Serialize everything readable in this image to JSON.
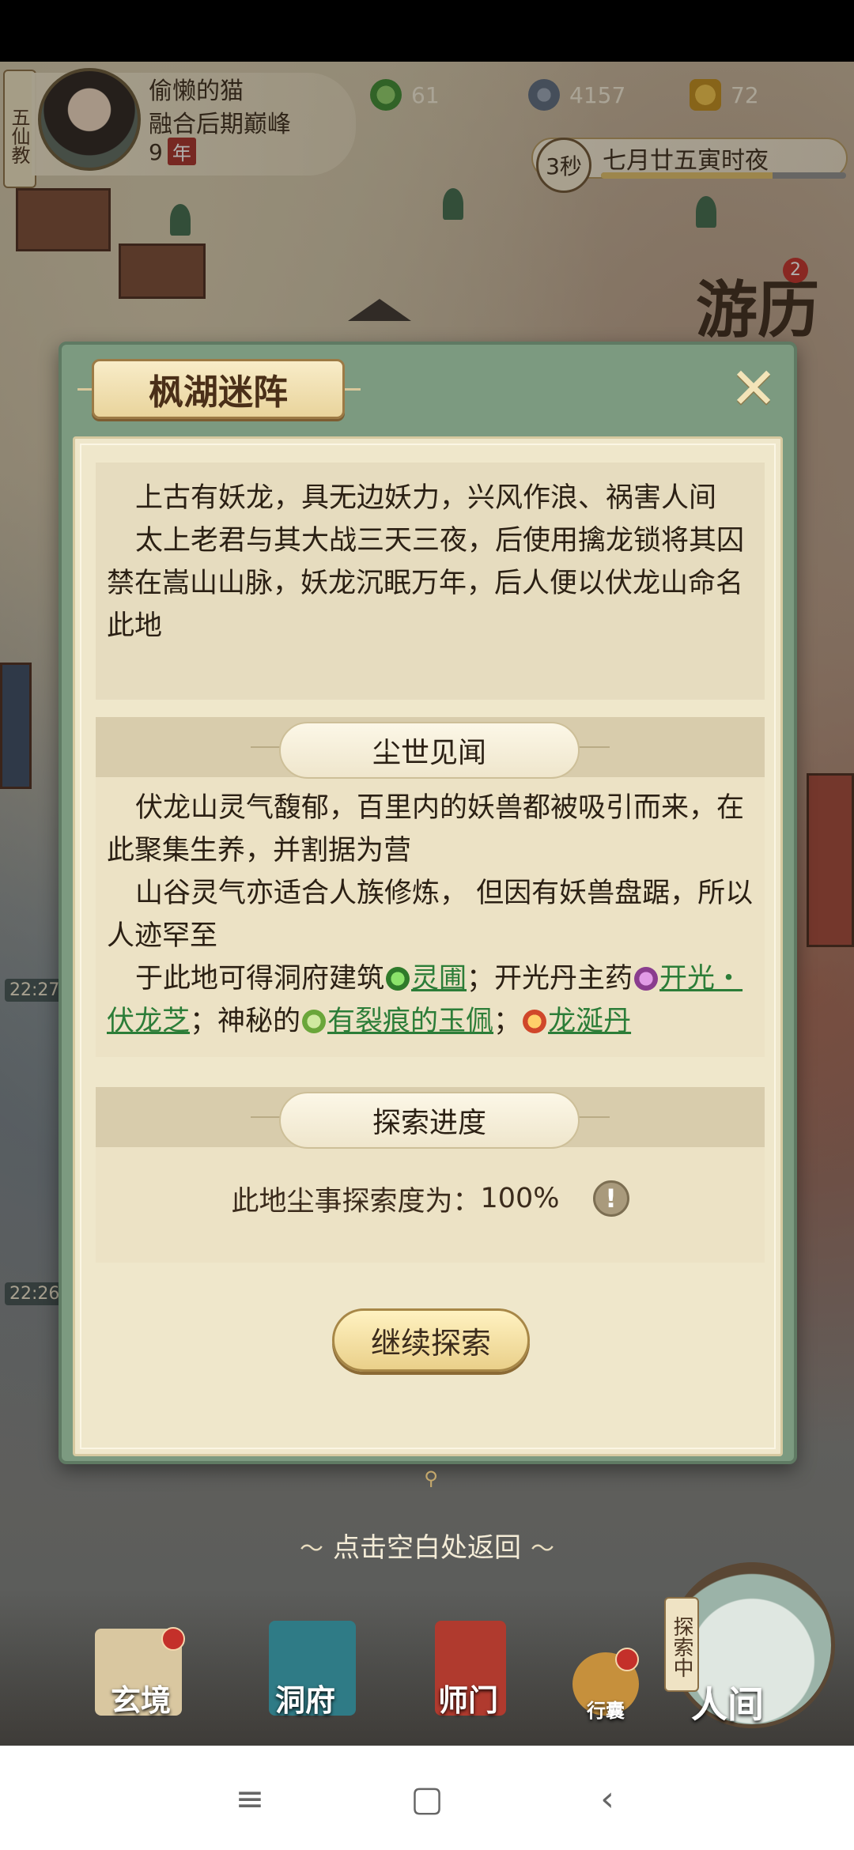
{
  "hud": {
    "sect": "五仙教",
    "player_name": "偷懒的猫",
    "realm": "融合后期巅峰",
    "years": "9",
    "years_unit": "年",
    "resources": [
      {
        "icon": "spirit-jade-icon",
        "value": "61"
      },
      {
        "icon": "copper-coin-icon",
        "value": "4157"
      },
      {
        "icon": "gold-ingot-icon",
        "value": "72"
      }
    ],
    "timer": "3秒",
    "date_text": "七月廿五寅时夜"
  },
  "side": {
    "travel_label": "游历",
    "travel_badge": "2",
    "clock_a": "22:27",
    "clock_b": "22:26"
  },
  "dialog": {
    "title": "枫湖迷阵",
    "close_label": "✕",
    "story": [
      "上古有妖龙，具无边妖力，兴风作浪、祸害人间",
      "太上老君与其大战三天三夜，后使用擒龙锁将其囚禁在嵩山山脉，妖龙沉眠万年，后人便以伏龙山命名此地"
    ],
    "lore_section": {
      "title": "尘世见闻",
      "p1": "伏龙山灵气馥郁，百里内的妖兽都被吸引而来，在此聚集生养，并割据为营",
      "p2": "山谷灵气亦适合人族修炼， 但因有妖兽盘踞，所以人迹罕至",
      "p3_prefix": "于此地可得洞府建筑",
      "link1": "灵圃",
      "p3_mid1": "；开光丹主药",
      "link2": "开光・伏龙芝",
      "p3_mid2": "；神秘的",
      "link3": "有裂痕的玉佩",
      "p3_mid3": "；",
      "link4": "龙涎丹"
    },
    "progress_section": {
      "title": "探索进度",
      "label": "此地尘事探索度为：",
      "value": "100%",
      "info_label": "!"
    },
    "continue_label": "继续探索"
  },
  "return_hint": "点击空白处返回",
  "game_nav": {
    "items": [
      "玄境",
      "洞府",
      "师门",
      "行囊",
      "人间"
    ],
    "explore_tag": "探索中"
  },
  "colors": {
    "dialog_frame": "#7c9a80",
    "paper": "#efe7cb",
    "link": "#2c7d38",
    "badge_red": "#c4302a"
  }
}
